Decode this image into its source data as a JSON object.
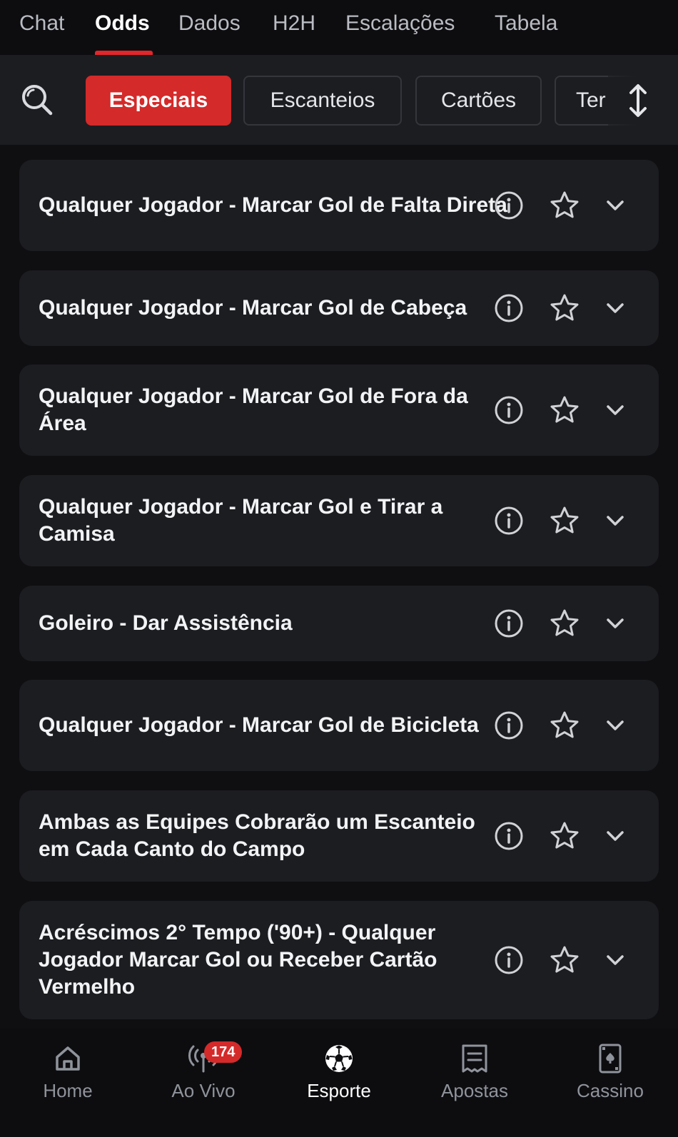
{
  "top_tabs": [
    "Chat",
    "Odds",
    "Dados",
    "H2H",
    "Escalações",
    "Tabela"
  ],
  "active_top_tab": "Odds",
  "filter_chips": [
    "Especiais",
    "Escanteios",
    "Cartões",
    "Ter"
  ],
  "active_filter": "Especiais",
  "markets": [
    "Qualquer Jogador - Marcar Gol de Falta Direta",
    "Qualquer Jogador - Marcar Gol de Cabeça",
    "Qualquer Jogador - Marcar Gol de Fora da Área",
    "Qualquer Jogador - Marcar Gol e Tirar a Camisa",
    "Goleiro - Dar Assistência",
    "Qualquer Jogador - Marcar Gol de Bicicleta",
    "Ambas as Equipes Cobrarão um Escanteio em Cada Canto do Campo",
    "Acréscimos 2° Tempo ('90+) - Qualquer Jogador Marcar Gol ou Receber Cartão Vermelho"
  ],
  "market_icons": [
    "info-icon",
    "star-icon",
    "chevron-down-icon"
  ],
  "bottom_nav": {
    "items": [
      "Home",
      "Ao Vivo",
      "Esporte",
      "Apostas",
      "Cassino"
    ],
    "active": "Esporte",
    "live_badge": "174"
  },
  "colors": {
    "accent": "#d42a2a",
    "background": "#0f0f12",
    "card": "#1c1d21"
  }
}
